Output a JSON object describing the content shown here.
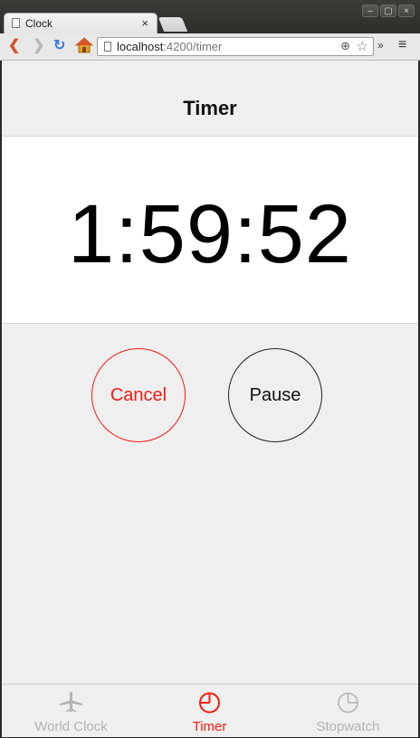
{
  "browser": {
    "tab_title": "Clock",
    "tab_close": "×",
    "url_host": "localhost",
    "url_path": ":4200/timer",
    "window_controls": [
      "–",
      "▢",
      "×"
    ]
  },
  "header": {
    "title": "Timer"
  },
  "timer": {
    "display": "1:59:52"
  },
  "buttons": {
    "cancel": "Cancel",
    "pause": "Pause"
  },
  "tabs": [
    {
      "label": "World Clock",
      "icon": "airplane-icon",
      "active": false
    },
    {
      "label": "Timer",
      "icon": "timer-icon",
      "active": true
    },
    {
      "label": "Stopwatch",
      "icon": "stopwatch-icon",
      "active": false
    }
  ],
  "colors": {
    "accent": "#f01c12",
    "inactive": "#b3b3b3"
  }
}
